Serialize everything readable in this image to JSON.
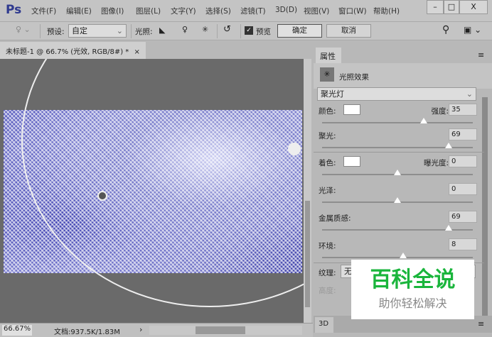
{
  "app": {
    "logo": "Ps",
    "menu": [
      "文件(F)",
      "编辑(E)",
      "图像(I)",
      "图层(L)",
      "文字(Y)",
      "选择(S)",
      "滤镜(T)",
      "3D(D)",
      "视图(V)",
      "窗口(W)",
      "帮助(H)"
    ],
    "win": [
      "–",
      "□",
      "X"
    ]
  },
  "options": {
    "preset_label": "预设:",
    "preset_value": "自定",
    "lights_label": "光照:",
    "preview_label": "预览",
    "preview_checked": true,
    "ok": "确定",
    "cancel": "取消"
  },
  "document": {
    "tab": "未标题-1 @ 66.7% (光效, RGB/8#) *",
    "close": "×"
  },
  "status": {
    "zoom": "66.67%",
    "doc": "文档:937.5K/1.83M",
    "arrow": "›"
  },
  "panel": {
    "tab": "属性",
    "title": "光照效果",
    "light_type": "聚光灯",
    "color_label": "颜色:",
    "intensity_label": "强度:",
    "intensity": "35",
    "intensity_frac": 0.675,
    "hotspot_label": "聚光:",
    "hotspot": "69",
    "hotspot_frac": 0.84,
    "colorize_label": "着色:",
    "exposure_label": "曝光度:",
    "exposure": "0",
    "exposure_frac": 0.5,
    "gloss_label": "光泽:",
    "gloss": "0",
    "gloss_frac": 0.5,
    "metallic_label": "金属质感:",
    "metallic": "69",
    "metallic_frac": 0.84,
    "ambience_label": "环境:",
    "ambience": "8",
    "ambience_frac": 0.54,
    "texture_label": "纹理:",
    "texture_value": "无",
    "height_label": "高度:",
    "tab3d": "3D"
  },
  "watermark": {
    "title": "百科全说",
    "subtitle": "助你轻松解决",
    "color": "#1ab53c"
  }
}
